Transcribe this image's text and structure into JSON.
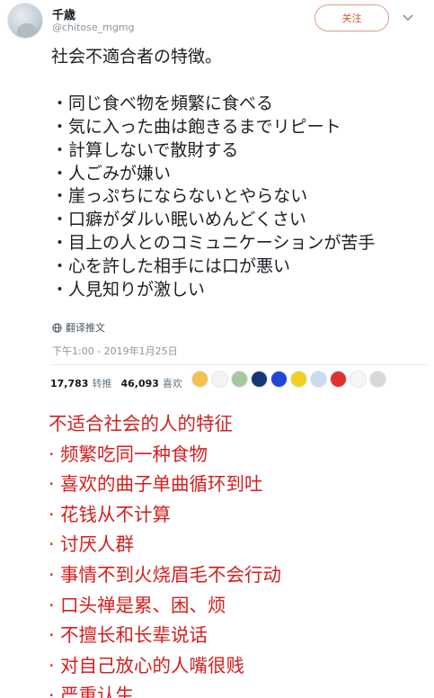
{
  "tweet": {
    "author_name": "千歳",
    "author_handle": "@chitose_mgmg",
    "follow_label": "关注",
    "body": "社会不適合者の特徴。\n\n・同じ食べ物を頻繁に食べる\n・気に入った曲は飽きるまでリピート\n・計算しないで散財する\n・人ごみが嫌い\n・崖っぷちにならないとやらない\n・口癖がダルい眠いめんどくさい\n・目上の人とのコミュニケーションが苦手\n・心を許した相手には口が悪い\n・人見知りが激しい",
    "translate_label": "翻译推文",
    "timestamp": "下午1:00 - 2019年1月25日",
    "retweets_count": "17,783",
    "retweets_label": "转推",
    "likes_count": "46,093",
    "likes_label": "喜欢",
    "liker_colors": [
      "#f2c14e",
      "#f4f4f4",
      "#a5c8a0",
      "#16357a",
      "#2246d8",
      "#f0d020",
      "#c8dcef",
      "#e03030",
      "#f6f6f6",
      "#d8d8d8"
    ]
  },
  "translation": {
    "text": "不适合社会的人的特征\n· 频繁吃同一种食物\n· 喜欢的曲子单曲循环到吐\n· 花钱从不计算\n· 讨厌人群\n· 事情不到火烧眉毛不会行动\n· 口头禅是累、困、烦\n· 不擅长和长辈说话\n· 对自己放心的人嘴很贱\n· 严重认生"
  }
}
